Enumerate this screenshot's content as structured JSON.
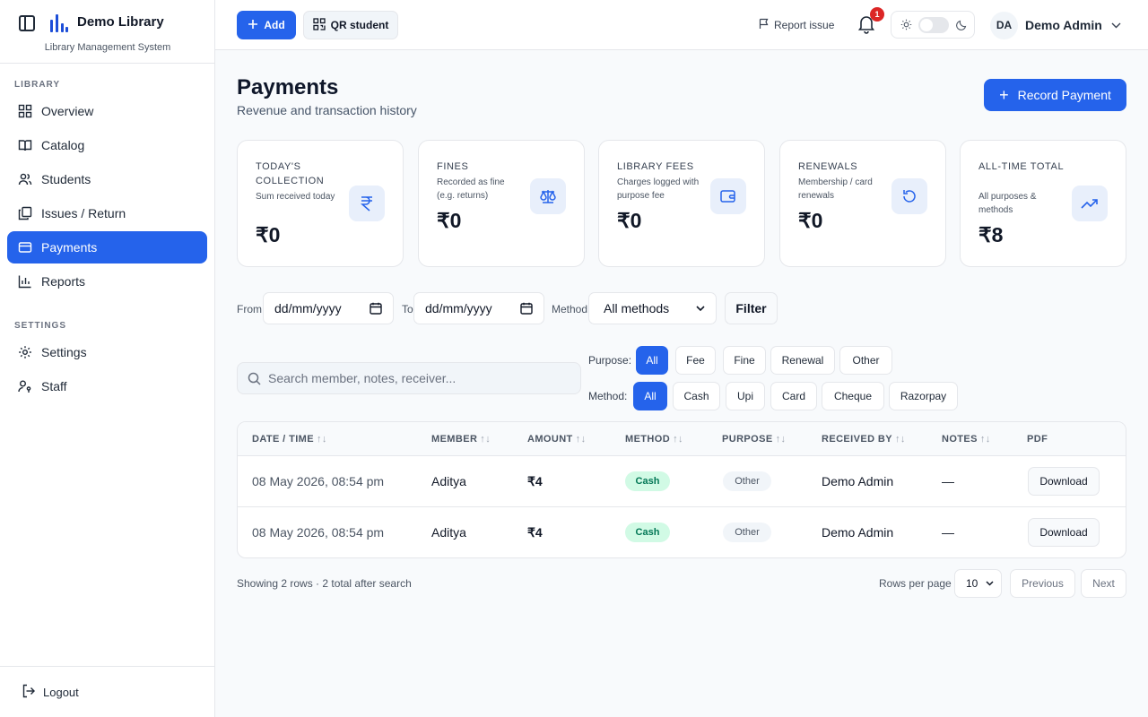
{
  "brand": {
    "name": "Demo Library",
    "tagline": "Library Management System"
  },
  "sidebar": {
    "library_label": "LIBRARY",
    "settings_label": "SETTINGS",
    "items": [
      {
        "label": "Overview",
        "icon": "grid-icon"
      },
      {
        "label": "Catalog",
        "icon": "book-open-icon"
      },
      {
        "label": "Students",
        "icon": "users-icon"
      },
      {
        "label": "Issues / Return",
        "icon": "copy-icon"
      },
      {
        "label": "Payments",
        "icon": "credit-card-icon",
        "active": true
      },
      {
        "label": "Reports",
        "icon": "bar-chart-icon"
      }
    ],
    "settings_items": [
      {
        "label": "Settings",
        "icon": "gear-icon"
      },
      {
        "label": "Staff",
        "icon": "user-key-icon"
      }
    ],
    "logout_label": "Logout"
  },
  "topbar": {
    "add_label": "Add",
    "qr_label": "QR student",
    "report_label": "Report issue",
    "notification_count": "1",
    "user_initials": "DA",
    "user_name": "Demo Admin"
  },
  "page": {
    "title": "Payments",
    "subtitle": "Revenue and transaction history",
    "record_label": "Record Payment"
  },
  "cards": [
    {
      "title": "TODAY'S COLLECTION",
      "sub": "Sum received today",
      "value": "₹0",
      "icon": "rupee-icon"
    },
    {
      "title": "FINES",
      "sub": "Recorded as fine (e.g. returns)",
      "value": "₹0",
      "icon": "scale-icon"
    },
    {
      "title": "LIBRARY FEES",
      "sub": "Charges logged with purpose fee",
      "value": "₹0",
      "icon": "wallet-icon"
    },
    {
      "title": "RENEWALS",
      "sub": "Membership / card renewals",
      "value": "₹0",
      "icon": "refresh-icon"
    },
    {
      "title": "ALL-TIME TOTAL",
      "sub": "All purposes & methods",
      "value": "₹8",
      "icon": "trending-up-icon"
    }
  ],
  "filters": {
    "from_label": "From",
    "to_label": "To",
    "method_label": "Method",
    "from_value": "dd/mm/yyyy",
    "to_value": "dd/mm/yyyy",
    "method_value": "All methods",
    "filter_label": "Filter"
  },
  "search": {
    "placeholder": "Search member, notes, receiver..."
  },
  "purpose_filter": {
    "label": "Purpose:",
    "options": [
      "All",
      "Fee",
      "Fine",
      "Renewal",
      "Other"
    ],
    "selected": "All"
  },
  "method_filter": {
    "label": "Method:",
    "options": [
      "All",
      "Cash",
      "Upi",
      "Card",
      "Cheque",
      "Razorpay"
    ],
    "selected": "All"
  },
  "table": {
    "headers": [
      "DATE / TIME",
      "MEMBER",
      "AMOUNT",
      "METHOD",
      "PURPOSE",
      "RECEIVED BY",
      "NOTES",
      "PDF"
    ],
    "rows": [
      {
        "datetime": "08 May 2026, 08:54 pm",
        "member": "Aditya",
        "amount": "₹4",
        "method": "Cash",
        "purpose": "Other",
        "received_by": "Demo Admin",
        "notes": "—",
        "pdf": "Download"
      },
      {
        "datetime": "08 May 2026, 08:54 pm",
        "member": "Aditya",
        "amount": "₹4",
        "method": "Cash",
        "purpose": "Other",
        "received_by": "Demo Admin",
        "notes": "—",
        "pdf": "Download"
      }
    ]
  },
  "footer": {
    "showing": "Showing 2 rows · 2 total after search",
    "rows_per_page_label": "Rows per page",
    "rows_per_page": "10",
    "previous": "Previous",
    "next": "Next"
  },
  "colors": {
    "accent": "#2563eb",
    "cash_bg": "#d1fae5",
    "cash_text": "#047857",
    "badge": "#dc2626"
  }
}
